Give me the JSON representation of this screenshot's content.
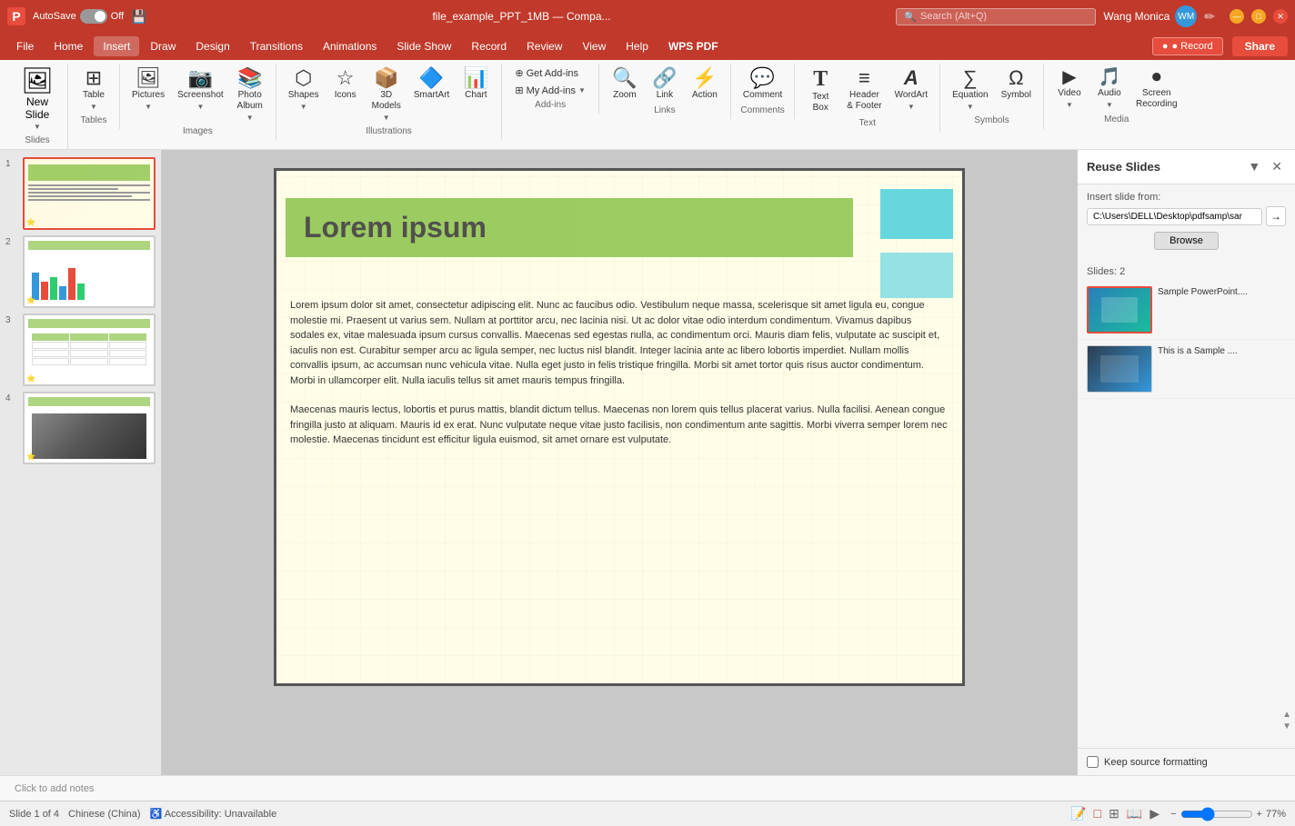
{
  "app": {
    "logo": "P",
    "autosave_label": "AutoSave",
    "autosave_state": "Off",
    "file_title": "file_example_PPT_1MB — Compa...",
    "search_placeholder": "Search (Alt+Q)",
    "user_name": "Wang Monica",
    "window_title": "file_example_PPT_1MB"
  },
  "title_bar": {
    "save_icon": "💾",
    "pencil_icon": "✏"
  },
  "menu": {
    "items": [
      "File",
      "Home",
      "Insert",
      "Draw",
      "Design",
      "Transitions",
      "Animations",
      "Slide Show",
      "Record",
      "Review",
      "View",
      "Help",
      "WPS PDF"
    ],
    "active_item": "Insert",
    "record_label": "● Record",
    "share_label": "Share"
  },
  "ribbon": {
    "groups": [
      {
        "name": "Slides",
        "items": [
          {
            "label": "New\nSlide",
            "icon": "🖼",
            "type": "large"
          }
        ]
      },
      {
        "name": "Tables",
        "items": [
          {
            "label": "Table",
            "icon": "⊞",
            "type": "large"
          }
        ]
      },
      {
        "name": "Images",
        "items": [
          {
            "label": "Pictures",
            "icon": "🖼"
          },
          {
            "label": "Screenshot",
            "icon": "📷"
          },
          {
            "label": "Photo\nAlbum",
            "icon": "📚"
          }
        ]
      },
      {
        "name": "Illustrations",
        "items": [
          {
            "label": "Shapes",
            "icon": "⬡"
          },
          {
            "label": "Icons",
            "icon": "☆"
          },
          {
            "label": "3D\nModels",
            "icon": "📦"
          },
          {
            "label": "SmartArt",
            "icon": "🔷"
          },
          {
            "label": "Chart",
            "icon": "📊"
          }
        ]
      },
      {
        "name": "Add-ins",
        "items": [
          {
            "label": "Get Add-ins",
            "icon": "⊕"
          },
          {
            "label": "My Add-ins",
            "icon": "⊞"
          }
        ]
      },
      {
        "name": "Links",
        "items": [
          {
            "label": "Zoom",
            "icon": "🔍"
          },
          {
            "label": "Link",
            "icon": "🔗"
          },
          {
            "label": "Action",
            "icon": "⚡"
          }
        ]
      },
      {
        "name": "Comments",
        "items": [
          {
            "label": "Comment",
            "icon": "💬",
            "type": "large"
          }
        ]
      },
      {
        "name": "Text",
        "items": [
          {
            "label": "Text\nBox",
            "icon": "T"
          },
          {
            "label": "Header\n& Footer",
            "icon": "≡"
          },
          {
            "label": "WordArt",
            "icon": "A"
          }
        ]
      },
      {
        "name": "Symbols",
        "items": [
          {
            "label": "Equation",
            "icon": "∑"
          },
          {
            "label": "Symbol",
            "icon": "Ω"
          }
        ]
      },
      {
        "name": "Media",
        "items": [
          {
            "label": "Video",
            "icon": "▶"
          },
          {
            "label": "Audio",
            "icon": "🎵"
          },
          {
            "label": "Screen\nRecording",
            "icon": "⏺"
          }
        ]
      }
    ]
  },
  "slides": [
    {
      "num": 1,
      "active": true,
      "starred": true
    },
    {
      "num": 2,
      "active": false,
      "starred": true
    },
    {
      "num": 3,
      "active": false,
      "starred": true
    },
    {
      "num": 4,
      "active": false,
      "starred": true
    }
  ],
  "slide_content": {
    "title": "Lorem ipsum",
    "paragraph1": "Lorem ipsum dolor sit amet, consectetur adipiscing elit. Nunc ac faucibus odio. Vestibulum neque massa, scelerisque sit amet ligula eu, congue molestie mi. Praesent ut varius sem. Nullam at porttitor arcu, nec lacinia nisi. Ut ac dolor vitae odio interdum condimentum. Vivamus dapibus sodales ex, vitae malesuada ipsum cursus convallis. Maecenas sed egestas nulla, ac condimentum orci. Mauris diam felis, vulputate ac suscipit et, iaculis non est. Curabitur semper arcu ac ligula semper, nec luctus nisl blandit. Integer lacinia ante ac libero lobortis imperdiet. Nullam mollis convallis ipsum, ac accumsan nunc vehicula vitae. Nulla eget justo in felis tristique fringilla. Morbi sit amet tortor quis risus auctor condimentum. Morbi in ullamcorper elit. Nulla iaculis tellus sit amet mauris tempus fringilla.",
    "paragraph2": "Maecenas mauris lectus, lobortis et purus mattis, blandit dictum tellus. Maecenas non lorem quis tellus placerat varius. Nulla facilisi. Aenean congue fringilla justo at aliquam. Mauris id ex erat. Nunc vulputate neque vitae justo facilisis, non condimentum ante sagittis. Morbi viverra semper lorem nec molestie. Maecenas tincidunt est efficitur ligula euismod, sit amet ornare est vulputate."
  },
  "reuse_panel": {
    "title": "Reuse Slides",
    "insert_from_label": "Insert slide from:",
    "path_value": "C:\\Users\\DELL\\Desktop\\pdfsamp\\sar",
    "browse_label": "Browse",
    "slides_count": "Slides: 2",
    "slide1_label": "Sample PowerPoint....",
    "slide2_label": "This is a Sample ....",
    "keep_formatting_label": "Keep source formatting"
  },
  "status_bar": {
    "slide_info": "Slide 1 of 4",
    "language": "Chinese (China)",
    "accessibility": "Accessibility: Unavailable",
    "notes_label": "Notes",
    "zoom_level": "77%"
  },
  "notes": {
    "placeholder": "Click to add notes"
  }
}
